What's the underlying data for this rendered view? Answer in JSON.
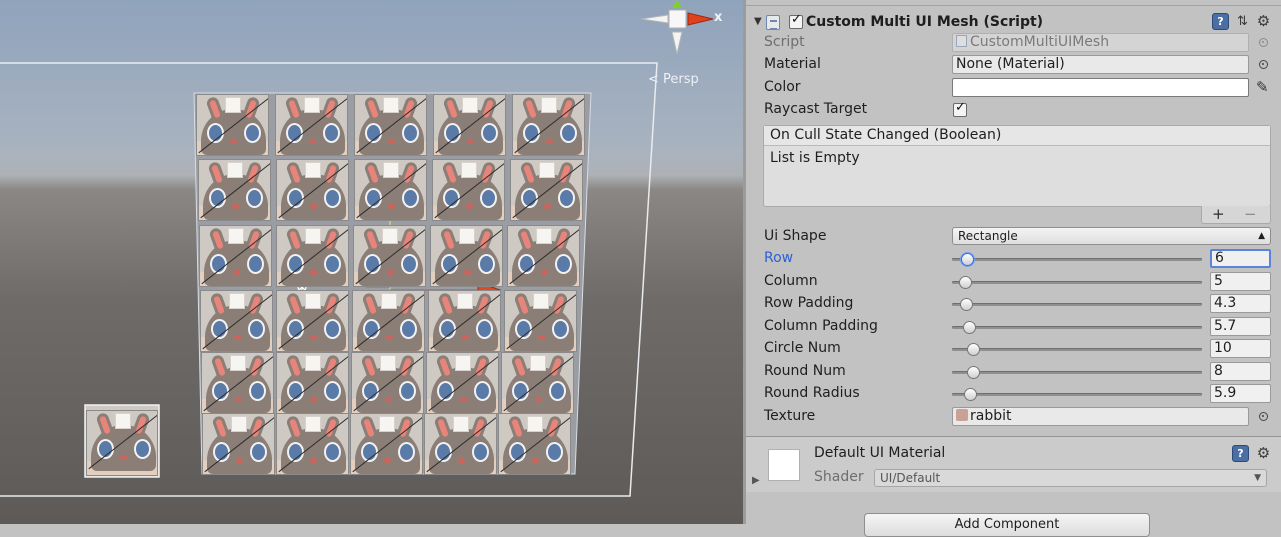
{
  "scene": {
    "persp_label": "< Persp",
    "gizmo_axis_label": "x",
    "grid_rows": 6,
    "grid_cols": 5
  },
  "inspector": {
    "component": {
      "title": "Custom Multi UI Mesh (Script)",
      "enabled": true,
      "icons": [
        "script-icon",
        "help-icon",
        "preset-icon",
        "gear-icon"
      ]
    },
    "script": {
      "label": "Script",
      "value": "CustomMultiUIMesh"
    },
    "material": {
      "label": "Material",
      "value": "None (Material)"
    },
    "color": {
      "label": "Color",
      "value": "#ffffff"
    },
    "raycast": {
      "label": "Raycast Target",
      "checked": true
    },
    "event": {
      "header": "On Cull State Changed (Boolean)",
      "empty_text": "List is Empty",
      "add_symbol": "+",
      "remove_symbol": "−"
    },
    "ui_shape": {
      "label": "Ui Shape",
      "value": "Rectangle"
    },
    "sliders": [
      {
        "label": "Row",
        "value": "6",
        "active": true
      },
      {
        "label": "Column",
        "value": "5"
      },
      {
        "label": "Row Padding",
        "value": "4.3"
      },
      {
        "label": "Column Padding",
        "value": "5.7"
      },
      {
        "label": "Circle Num",
        "value": "10"
      },
      {
        "label": "Round Num",
        "value": "8"
      },
      {
        "label": "Round Radius",
        "value": "5.9"
      }
    ],
    "texture": {
      "label": "Texture",
      "value": "rabbit"
    },
    "material_block": {
      "name": "Default UI Material",
      "shader_label": "Shader",
      "shader_value": "UI/Default"
    },
    "add_component": "Add Component"
  }
}
